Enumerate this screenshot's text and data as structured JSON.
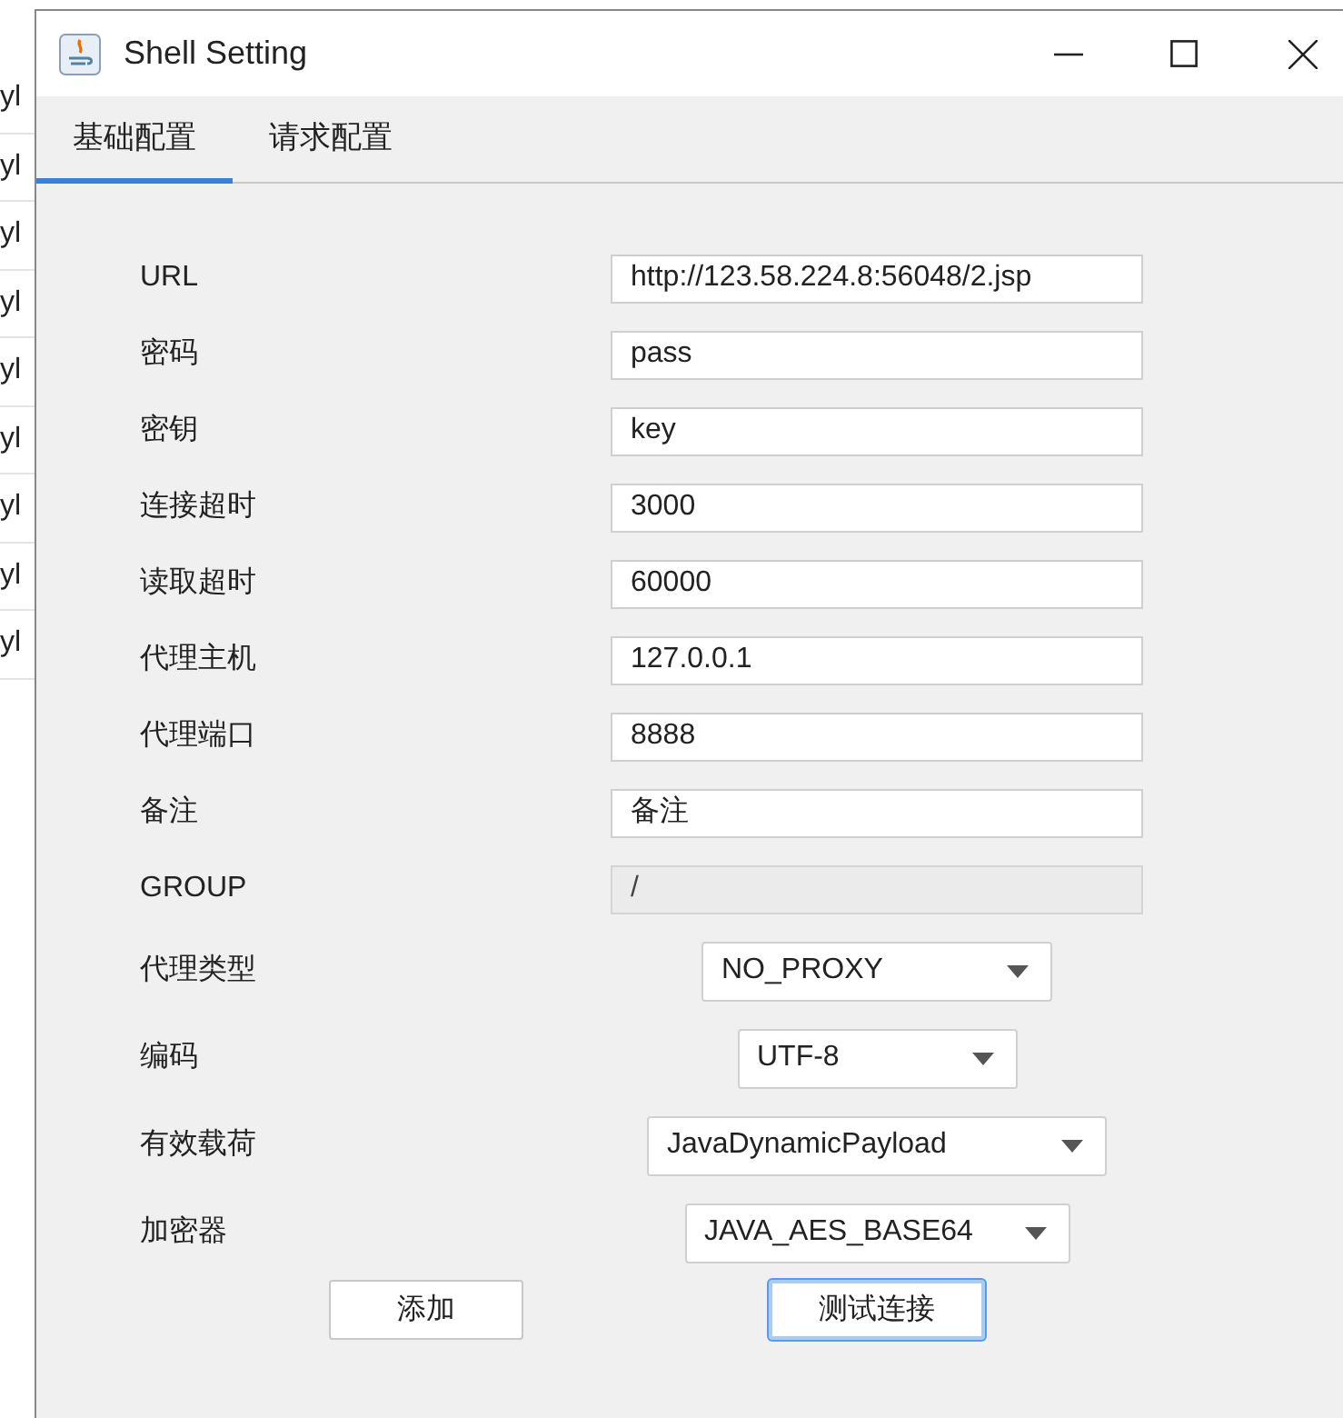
{
  "background_rows": [
    "yl",
    "yl",
    "yl",
    "yl",
    "yl",
    "yl",
    "yl",
    "yl",
    "yl"
  ],
  "window": {
    "title": "Shell Setting"
  },
  "tabs": [
    {
      "label": "基础配置",
      "selected": true
    },
    {
      "label": "请求配置",
      "selected": false
    }
  ],
  "fields": [
    {
      "kind": "text",
      "label": "URL",
      "value": "http://123.58.224.8:56048/2.jsp",
      "disabled": false
    },
    {
      "kind": "text",
      "label": "密码",
      "value": "pass",
      "disabled": false
    },
    {
      "kind": "text",
      "label": "密钥",
      "value": "key",
      "disabled": false
    },
    {
      "kind": "text",
      "label": "连接超时",
      "value": "3000",
      "disabled": false
    },
    {
      "kind": "text",
      "label": "读取超时",
      "value": "60000",
      "disabled": false
    },
    {
      "kind": "text",
      "label": "代理主机",
      "value": "127.0.0.1",
      "disabled": false
    },
    {
      "kind": "text",
      "label": "代理端口",
      "value": "8888",
      "disabled": false
    },
    {
      "kind": "text",
      "label": "备注",
      "value": "备注",
      "disabled": false
    },
    {
      "kind": "text",
      "label": "GROUP",
      "value": "/",
      "disabled": true
    },
    {
      "kind": "combo",
      "label": "代理类型",
      "value": "NO_PROXY"
    },
    {
      "kind": "combo",
      "label": "编码",
      "value": "UTF-8"
    },
    {
      "kind": "combo",
      "label": "有效载荷",
      "value": "JavaDynamicPayload"
    },
    {
      "kind": "combo",
      "label": "加密器",
      "value": "JAVA_AES_BASE64"
    }
  ],
  "buttons": [
    {
      "label": "添加",
      "focused": false
    },
    {
      "label": "测试连接",
      "focused": true
    }
  ]
}
